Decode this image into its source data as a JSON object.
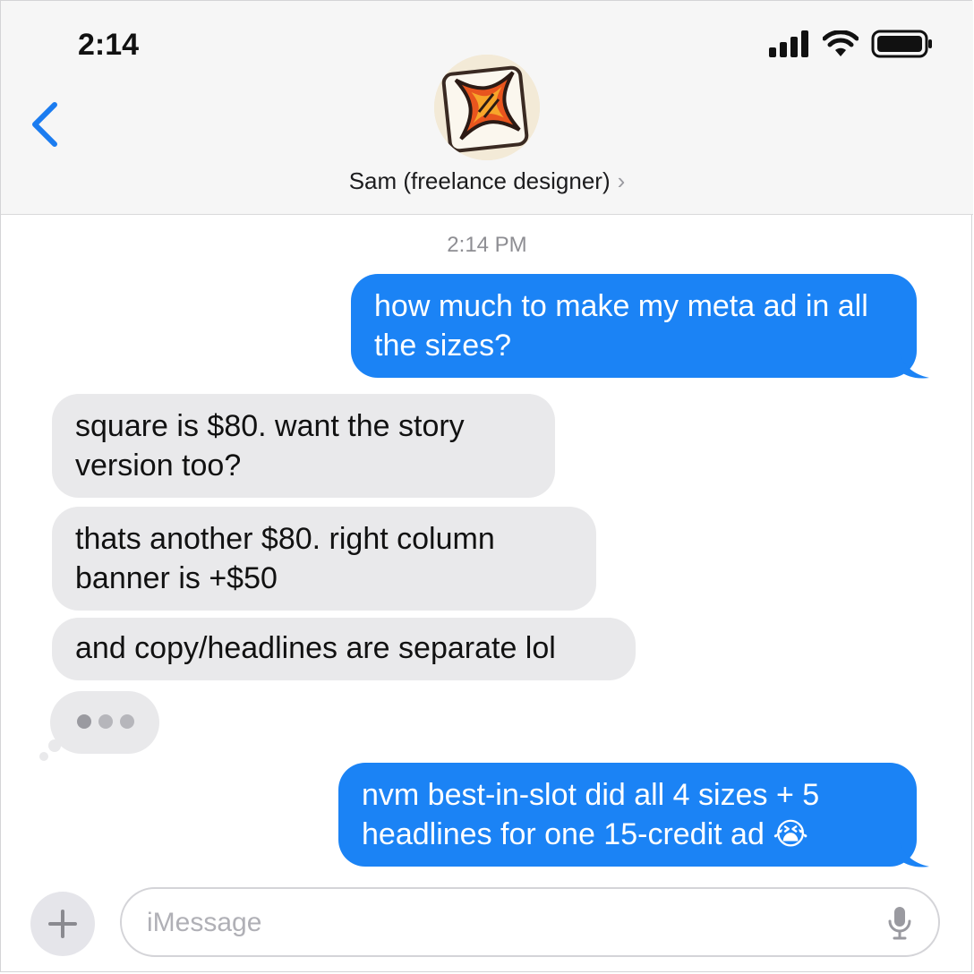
{
  "status": {
    "time": "2:14"
  },
  "header": {
    "contact_name": "Sam (freelance designer)",
    "chevron": "›"
  },
  "thread": {
    "timestamp": "2:14 PM",
    "messages": [
      {
        "direction": "outgoing",
        "text": "how much to make my meta ad in all the sizes?"
      },
      {
        "direction": "incoming",
        "text": "square is $80. want the story version too?"
      },
      {
        "direction": "incoming",
        "text": "thats another $80. right column banner is +$50"
      },
      {
        "direction": "incoming",
        "text": "and copy/headlines are separate lol"
      },
      {
        "direction": "outgoing",
        "text": "nvm best-in-slot did all 4 sizes + 5 headlines for one 15-credit ad 😭"
      }
    ],
    "typing_indicator": true
  },
  "composer": {
    "placeholder": "iMessage",
    "value": ""
  },
  "colors": {
    "outgoing_bubble": "#1b83f5",
    "incoming_bubble": "#e9e9eb",
    "accent": "#1b7cf0"
  },
  "icons": [
    "signal-icon",
    "wifi-icon",
    "battery-icon",
    "back-chevron-icon",
    "plus-icon",
    "microphone-icon"
  ]
}
